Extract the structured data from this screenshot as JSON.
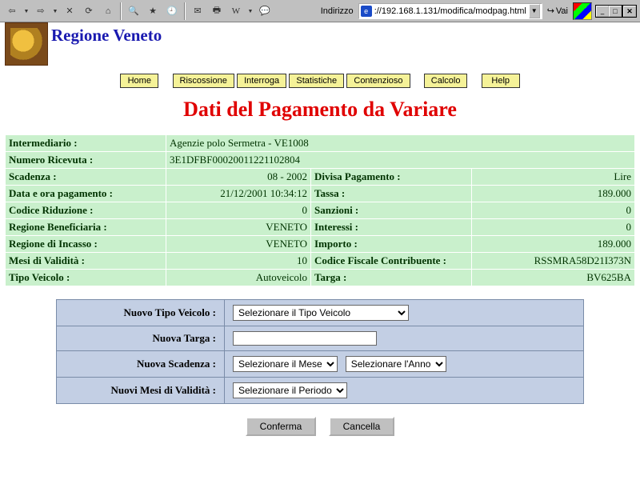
{
  "browser": {
    "address_label": "Indirizzo",
    "url": "://192.168.1.131/modifica/modpag.html",
    "go_label": "Vai"
  },
  "header": {
    "org_title": "Regione Veneto"
  },
  "nav": {
    "home": "Home",
    "riscossione": "Riscossione",
    "interroga": "Interroga",
    "statistiche": "Statistiche",
    "contenzioso": "Contenzioso",
    "calcolo": "Calcolo",
    "help": "Help"
  },
  "page_title": "Dati del Pagamento da Variare",
  "fields": {
    "intermediario_lbl": "Intermediario :",
    "intermediario_val": "Agenzie polo Sermetra - VE1008",
    "numero_ricevuta_lbl": "Numero Ricevuta :",
    "numero_ricevuta_val": "3E1DFBF00020011221102804",
    "scadenza_lbl": "Scadenza :",
    "scadenza_val": "08 - 2002",
    "divisa_lbl": "Divisa Pagamento :",
    "divisa_val": "Lire",
    "data_ora_lbl": "Data e ora pagamento :",
    "data_ora_val": "21/12/2001 10:34:12",
    "tassa_lbl": "Tassa :",
    "tassa_val": "189.000",
    "codice_riduzione_lbl": "Codice Riduzione :",
    "codice_riduzione_val": "0",
    "sanzioni_lbl": "Sanzioni :",
    "sanzioni_val": "0",
    "regione_benef_lbl": "Regione Beneficiaria :",
    "regione_benef_val": "VENETO",
    "interessi_lbl": "Interessi :",
    "interessi_val": "0",
    "regione_incasso_lbl": "Regione di Incasso :",
    "regione_incasso_val": "VENETO",
    "importo_lbl": "Importo :",
    "importo_val": "189.000",
    "mesi_validita_lbl": "Mesi di Validità :",
    "mesi_validita_val": "10",
    "cf_lbl": "Codice Fiscale Contribuente :",
    "cf_val": "RSSMRA58D21I373N",
    "tipo_veicolo_lbl": "Tipo Veicolo :",
    "tipo_veicolo_val": "Autoveicolo",
    "targa_lbl": "Targa :",
    "targa_val": "BV625BA"
  },
  "form": {
    "nuovo_tipo_veicolo_lbl": "Nuovo Tipo Veicolo :",
    "nuovo_tipo_veicolo_sel": "Selezionare il Tipo Veicolo",
    "nuova_targa_lbl": "Nuova Targa :",
    "nuova_targa_val": "",
    "nuova_scadenza_lbl": "Nuova Scadenza :",
    "nuova_scadenza_mese": "Selezionare il Mese",
    "nuova_scadenza_anno": "Selezionare l'Anno",
    "nuovi_mesi_lbl": "Nuovi Mesi di Validità :",
    "nuovi_mesi_sel": "Selezionare il Periodo"
  },
  "buttons": {
    "conferma": "Conferma",
    "cancella": "Cancella"
  }
}
